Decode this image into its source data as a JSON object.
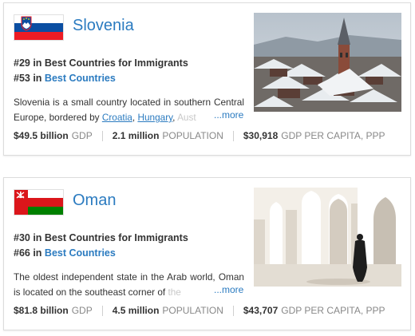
{
  "cards": [
    {
      "name": "Slovenia",
      "rank_immigrants": "#29 in Best Countries for Immigrants",
      "rank_best_prefix": "#53 in",
      "rank_best_link": "Best Countries",
      "desc_before": "Slovenia is a small country located in southern Central Europe, bordered by ",
      "desc_links": [
        "Croatia",
        "Hungary"
      ],
      "desc_fade": "Aust",
      "more": "...more",
      "stats": [
        {
          "value": "$49.5 billion",
          "label": "GDP"
        },
        {
          "value": "2.1 million",
          "label": "POPULATION"
        },
        {
          "value": "$30,918",
          "label": "GDP PER CAPITA, PPP"
        }
      ]
    },
    {
      "name": "Oman",
      "rank_immigrants": "#30 in Best Countries for Immigrants",
      "rank_best_prefix": "#66 in",
      "rank_best_link": "Best Countries",
      "desc_before": "The oldest independent state in the Arab world, Oman is located on the southeast corner of ",
      "desc_fade": "the",
      "more": "...more",
      "stats": [
        {
          "value": "$81.8 billion",
          "label": "GDP"
        },
        {
          "value": "4.5 million",
          "label": "POPULATION"
        },
        {
          "value": "$43,707",
          "label": "GDP PER CAPITA, PPP"
        }
      ]
    }
  ],
  "colors": {
    "link": "#2b7bc0",
    "slovenia_flag": [
      "#ffffff",
      "#0b4ea2",
      "#ed1c24"
    ],
    "oman_flag": [
      "#db161b",
      "#ffffff",
      "#008000"
    ]
  },
  "icons": [
    "slovenia-flag-icon",
    "oman-flag-icon"
  ]
}
